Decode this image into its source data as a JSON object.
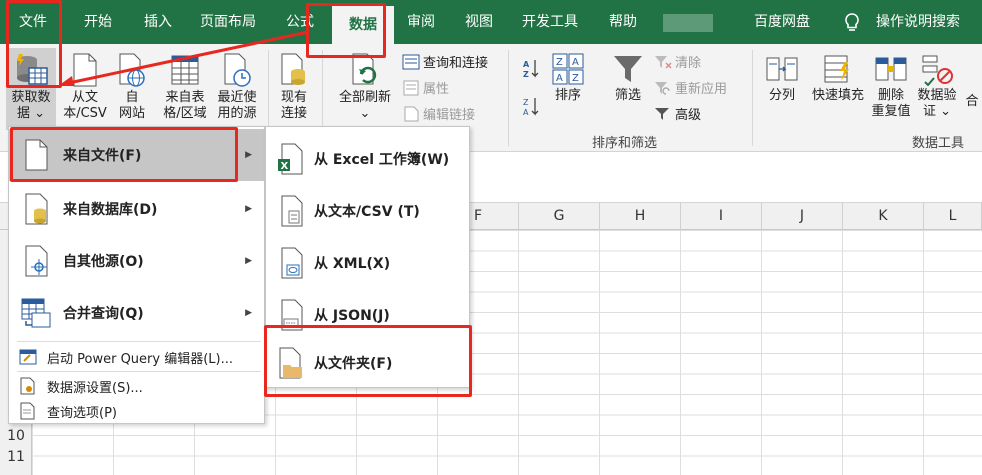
{
  "tabs": [
    "文件",
    "开始",
    "插入",
    "页面布局",
    "公式",
    "数据",
    "审阅",
    "视图",
    "开发工具",
    "帮助",
    "百度网盘",
    "操作说明搜索"
  ],
  "ribbon": {
    "get_data": [
      "获取数",
      "据 ⌄"
    ],
    "from_text_csv": [
      "从文",
      "本/CSV"
    ],
    "from_web": [
      "自",
      "网站"
    ],
    "from_table": [
      "来自表",
      "格/区域"
    ],
    "recent_sources": [
      "最近使",
      "用的源"
    ],
    "existing_conn": [
      "现有",
      "连接"
    ],
    "refresh_all": [
      "全部刷新",
      "⌄"
    ],
    "queries_connections": "查询和连接",
    "properties": "属性",
    "edit_links": "编辑链接",
    "sort": "排序",
    "filter": "筛选",
    "clear": "清除",
    "reapply": "重新应用",
    "advanced": "高级",
    "sort_filter_group": "排序和筛选",
    "text_to_columns": "分列",
    "flash_fill": "快速填充",
    "remove_duplicates": [
      "删除",
      "重复值"
    ],
    "data_validation": [
      "数据验",
      "证 ⌄"
    ],
    "consolidate": "合",
    "data_tools_group": "数据工具"
  },
  "columns": [
    "F",
    "G",
    "H",
    "I",
    "J",
    "K",
    "L"
  ],
  "rows": [
    "10",
    "11"
  ],
  "menu1": {
    "from_file": "来自文件(F)",
    "from_database": "来自数据库(D)",
    "from_other": "自其他源(O)",
    "combine": "合并查询(Q)",
    "launch_pq": "启动 Power Query 编辑器(L)...",
    "source_settings": "数据源设置(S)...",
    "query_options": "查询选项(P)"
  },
  "menu2": {
    "from_excel": "从 Excel 工作簿(W)",
    "from_text": "从文本/CSV (T)",
    "from_xml": "从 XML(X)",
    "from_json": "从 JSON(J)",
    "from_folder": "从文件夹(F)"
  },
  "colors": {
    "accent": "#217346",
    "highlight": "#e8281f",
    "menu_hover": "#c6c6c6"
  }
}
